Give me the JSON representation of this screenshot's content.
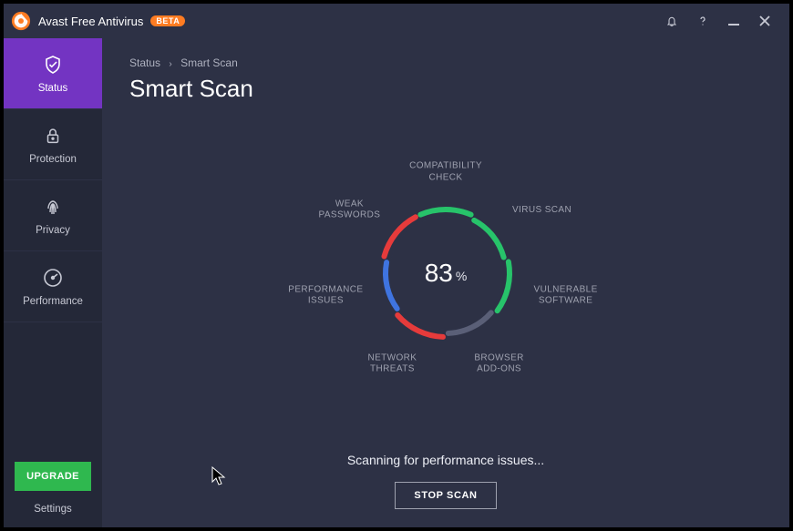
{
  "app": {
    "title": "Avast Free Antivirus",
    "badge": "BETA"
  },
  "colors": {
    "accent": "#7334c2",
    "upgrade": "#2fb84f",
    "badge": "#ff7c22"
  },
  "sidebar": {
    "items": [
      {
        "id": "status",
        "label": "Status",
        "icon": "shield-icon",
        "active": true
      },
      {
        "id": "protection",
        "label": "Protection",
        "icon": "lock-icon",
        "active": false
      },
      {
        "id": "privacy",
        "label": "Privacy",
        "icon": "fingerprint-icon",
        "active": false
      },
      {
        "id": "performance",
        "label": "Performance",
        "icon": "gauge-icon",
        "active": false
      }
    ],
    "upgrade_label": "UPGRADE",
    "settings_label": "Settings"
  },
  "breadcrumb": {
    "root": "Status",
    "current": "Smart Scan"
  },
  "page": {
    "title": "Smart Scan"
  },
  "scan": {
    "percent": 83,
    "percent_symbol": "%",
    "status_text": "Scanning for performance issues...",
    "stop_label": "STOP SCAN",
    "categories": [
      {
        "id": "compat",
        "label": "COMPATIBILITY\nCHECK",
        "color": "#27c36a"
      },
      {
        "id": "virus",
        "label": "VIRUS SCAN",
        "color": "#27c36a"
      },
      {
        "id": "vuln",
        "label": "VULNERABLE\nSOFTWARE",
        "color": "#27c36a"
      },
      {
        "id": "addons",
        "label": "BROWSER\nADD-ONS",
        "color": "#5a5f77"
      },
      {
        "id": "network",
        "label": "NETWORK\nTHREATS",
        "color": "#e63b3b"
      },
      {
        "id": "perf",
        "label": "PERFORMANCE\nISSUES",
        "color": "#3f74e0"
      },
      {
        "id": "weakpw",
        "label": "WEAK\nPASSWORDS",
        "color": "#e63b3b"
      }
    ]
  }
}
